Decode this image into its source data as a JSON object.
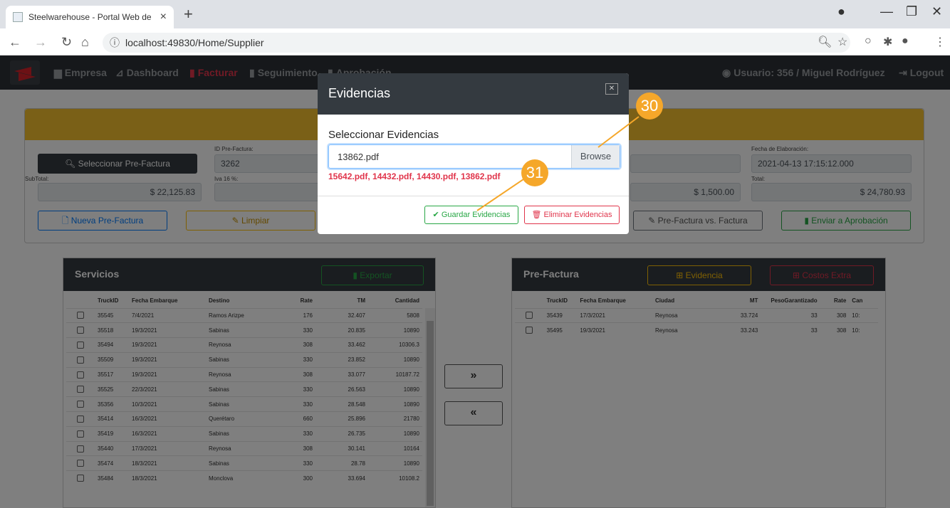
{
  "browser": {
    "tab_title": "Steelwarehouse - Portal Web de",
    "url": "localhost:49830/Home/Supplier"
  },
  "nav": {
    "items": [
      {
        "label": "Empresa",
        "icon": "chart-icon"
      },
      {
        "label": "Dashboard",
        "icon": "dashboard-icon"
      },
      {
        "label": "Facturar",
        "icon": "invoice-icon"
      },
      {
        "label": "Seguimiento",
        "icon": "clipboard-icon"
      },
      {
        "label": "Aprobación",
        "icon": "clipboard-icon"
      }
    ],
    "user": "Usuario: 356 / Miguel Rodríguez",
    "logout": "Logout"
  },
  "form": {
    "select_prefactura": "Seleccionar Pre-Factura",
    "id_prefactura_label": "ID Pre-Factura:",
    "id_prefactura_value": "3262",
    "subtotal_label": "SubTotal:",
    "subtotal_value": "$ 22,125.83",
    "iva_label": "Iva 16 %:",
    "fecha_label": "Fecha de Elaboración:",
    "fecha_value": "2021-04-13 17:15:12.000",
    "total_label": "Total:",
    "total_value": "$ 24,780.93",
    "extra_value": "$ 1,500.00",
    "btn_nueva": "Nueva Pre-Factura",
    "btn_limpiar": "Limpiar",
    "btn_comparar": "Pre-Factura vs. Factura",
    "btn_enviar": "Enviar a Aprobación"
  },
  "servicios": {
    "title": "Servicios",
    "export": "Exportar",
    "headers": [
      "TruckID",
      "Fecha Embarque",
      "Destino",
      "Rate",
      "TM",
      "Cantidad"
    ],
    "rows": [
      [
        "35545",
        "7/4/2021",
        "Ramos Arizpe",
        "176",
        "32.407",
        "5808"
      ],
      [
        "35518",
        "19/3/2021",
        "Sabinas",
        "330",
        "20.835",
        "10890"
      ],
      [
        "35494",
        "19/3/2021",
        "Reynosa",
        "308",
        "33.462",
        "10306.3"
      ],
      [
        "35509",
        "19/3/2021",
        "Sabinas",
        "330",
        "23.852",
        "10890"
      ],
      [
        "35517",
        "19/3/2021",
        "Reynosa",
        "308",
        "33.077",
        "10187.72"
      ],
      [
        "35525",
        "22/3/2021",
        "Sabinas",
        "330",
        "26.563",
        "10890"
      ],
      [
        "35356",
        "10/3/2021",
        "Sabinas",
        "330",
        "28.548",
        "10890"
      ],
      [
        "35414",
        "16/3/2021",
        "Querétaro",
        "660",
        "25.896",
        "21780"
      ],
      [
        "35419",
        "16/3/2021",
        "Sabinas",
        "330",
        "26.735",
        "10890"
      ],
      [
        "35440",
        "17/3/2021",
        "Reynosa",
        "308",
        "30.141",
        "10164"
      ],
      [
        "35474",
        "18/3/2021",
        "Sabinas",
        "330",
        "28.78",
        "10890"
      ],
      [
        "35484",
        "18/3/2021",
        "Monclova",
        "300",
        "33.694",
        "10108.2"
      ]
    ]
  },
  "transfer": {
    "right": "»",
    "left": "«"
  },
  "prefactura": {
    "title": "Pre-Factura",
    "evidencia": "Evidencia",
    "costos_extra": "Costos Extra",
    "headers": [
      "TruckID",
      "Fecha Embarque",
      "Ciudad",
      "MT",
      "PesoGarantizado",
      "Rate",
      "Can"
    ],
    "rows": [
      [
        "35439",
        "17/3/2021",
        "Reynosa",
        "33.724",
        "33",
        "308",
        "10:"
      ],
      [
        "35495",
        "19/3/2021",
        "Reynosa",
        "33.243",
        "33",
        "308",
        "10:"
      ]
    ]
  },
  "modal": {
    "title": "Evidencias",
    "subtitle": "Seleccionar Evidencias",
    "file_value": "13862.pdf",
    "browse": "Browse",
    "file_list": "15642.pdf, 14432.pdf, 14430.pdf, 13862.pdf",
    "guardar": "Guardar Evidencias",
    "eliminar": "Eliminar Evidencias"
  },
  "callouts": [
    "30",
    "31"
  ],
  "colors": {
    "accent_red": "#e0344b",
    "band_yellow": "#f5c12e",
    "dark": "#343a40",
    "green": "#28a745",
    "callout": "#f5a72a"
  }
}
